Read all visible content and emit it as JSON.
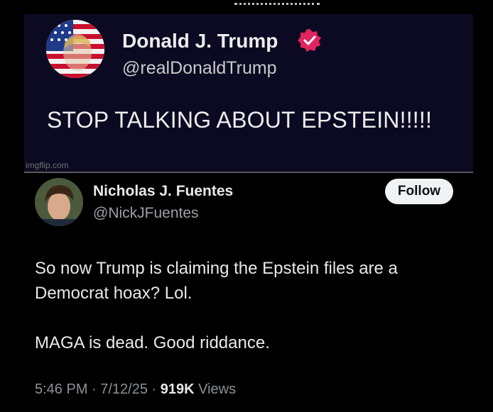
{
  "quoted_image": {
    "author_name": "Donald J. Trump",
    "author_handle": "@realDonaldTrump",
    "verified_icon": "verified-badge-icon",
    "text": "STOP TALKING ABOUT EPSTEIN!!!!!",
    "watermark": "imgflip.com",
    "background": "#0c0a22"
  },
  "tweet": {
    "author_name": "Nicholas J. Fuentes",
    "author_handle": "@NickJFuentes",
    "follow_label": "Follow",
    "paragraphs": [
      "So now Trump is claiming the Epstein files are a Democrat hoax? Lol.",
      "MAGA is dead. Good riddance."
    ],
    "timestamp": "5:46 PM · 7/12/25 · ",
    "views_count": "919K",
    "views_label": " Views"
  },
  "colors": {
    "background": "#000000",
    "follow_bg": "#eff3f4",
    "verified_badge": "#e0245e",
    "muted_text": "#8b9196"
  }
}
